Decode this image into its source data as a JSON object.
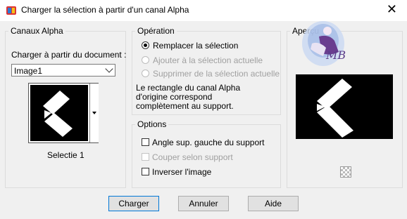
{
  "window": {
    "title": "Charger la sélection à partir d'un canal Alpha"
  },
  "canaux": {
    "legend": "Canaux Alpha",
    "load_from_label": "Charger à partir du document :",
    "document_selected": "Image1",
    "channel_caption": "Selectie 1"
  },
  "operation": {
    "legend": "Opération",
    "options": [
      {
        "label": "Remplacer la sélection",
        "checked": true,
        "enabled": true
      },
      {
        "label": "Ajouter à la sélection actuelle",
        "checked": false,
        "enabled": false
      },
      {
        "label": "Supprimer de la sélection actuelle",
        "checked": false,
        "enabled": false
      }
    ],
    "info": [
      "Le rectangle du canal Alpha",
      "d'origine correspond",
      "complètement au support."
    ]
  },
  "options": {
    "legend": "Options",
    "items": [
      {
        "label": "Angle sup. gauche du support",
        "checked": false,
        "enabled": true
      },
      {
        "label": "Couper selon support",
        "checked": false,
        "enabled": false
      },
      {
        "label": "Inverser l'image",
        "checked": false,
        "enabled": true
      }
    ]
  },
  "apercu": {
    "legend": "Aperçu",
    "watermark_text": "MB",
    "zoom_icon": "checkerboard-icon"
  },
  "buttons": {
    "ok": "Charger",
    "cancel": "Annuler",
    "help": "Aide"
  }
}
